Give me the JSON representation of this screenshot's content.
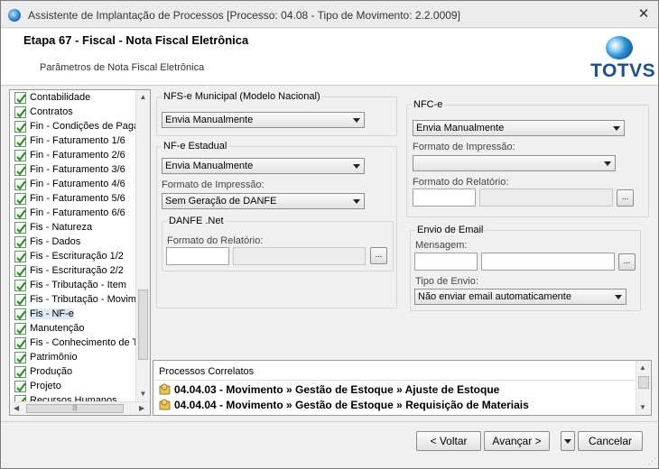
{
  "window": {
    "title": "Assistente de Implantação de Processos [Processo: 04.08 - Tipo de Movimento: 2.2.0009]",
    "close_glyph": "✕"
  },
  "header": {
    "step_title": "Etapa 67 - Fiscal - Nota Fiscal Eletrônica",
    "step_subtitle": "Parâmetros de Nota Fiscal Eletrônica",
    "logo_text": "TOTVS"
  },
  "tree": {
    "items": [
      {
        "label": "Contabilidade"
      },
      {
        "label": "Contratos"
      },
      {
        "label": "Fin - Condições de Paga"
      },
      {
        "label": "Fin - Faturamento 1/6"
      },
      {
        "label": "Fin - Faturamento 2/6"
      },
      {
        "label": "Fin - Faturamento 3/6"
      },
      {
        "label": "Fin - Faturamento 4/6"
      },
      {
        "label": "Fin - Faturamento 5/6"
      },
      {
        "label": "Fin - Faturamento 6/6"
      },
      {
        "label": "Fis - Natureza"
      },
      {
        "label": "Fis - Dados"
      },
      {
        "label": "Fis - Escrituração 1/2"
      },
      {
        "label": "Fis - Escrituração 2/2"
      },
      {
        "label": "Fis - Tributação - Item"
      },
      {
        "label": "Fis - Tributação - Movim"
      },
      {
        "label": "Fis - NF-e"
      },
      {
        "label": "Manutenção"
      },
      {
        "label": "Fis - Conhecimento de T"
      },
      {
        "label": "Patrimônio"
      },
      {
        "label": "Produção"
      },
      {
        "label": "Projeto"
      },
      {
        "label": "Recursos Humanos"
      }
    ],
    "selected_index": 15,
    "hscroll_thumb_glyph": "|||"
  },
  "nfse": {
    "legend": "NFS-e Municipal (Modelo Nacional)",
    "select_value": "Envia Manualmente"
  },
  "nfe": {
    "legend": "NF-e Estadual",
    "select_value": "Envia Manualmente",
    "format_label": "Formato de Impressão:",
    "format_value": "Sem Geração de DANFE",
    "danfe": {
      "legend": "DANFE .Net",
      "report_label": "Formato do Relatório:",
      "report_code": "",
      "report_desc": "",
      "browse_label": "..."
    }
  },
  "nfce": {
    "legend": "NFC-e",
    "select_value": "Envia Manualmente",
    "format_label": "Formato de Impressão:",
    "format_value": "",
    "report_label": "Formato do Relatório:",
    "report_code": "",
    "report_desc": "",
    "browse_label": "..."
  },
  "email": {
    "legend": "Envio de Email",
    "message_label": "Mensagem:",
    "message_code": "",
    "message_desc": "",
    "browse_label": "...",
    "send_type_label": "Tipo de Envio:",
    "send_type_value": "Não enviar email automaticamente"
  },
  "correlated": {
    "title": "Processos Correlatos",
    "rows": [
      {
        "text": "04.04.03 - Movimento » Gestão de Estoque » Ajuste de Estoque"
      },
      {
        "text": "04.04.04 - Movimento » Gestão de Estoque » Requisição de Materiais"
      }
    ]
  },
  "footer": {
    "back_label": "< Voltar",
    "next_label": "Avançar >",
    "cancel_label": "Cancelar"
  },
  "colors": {
    "brand": "#1d4f8e",
    "selection": "#dde8f6",
    "check": "#2e8b2e"
  }
}
